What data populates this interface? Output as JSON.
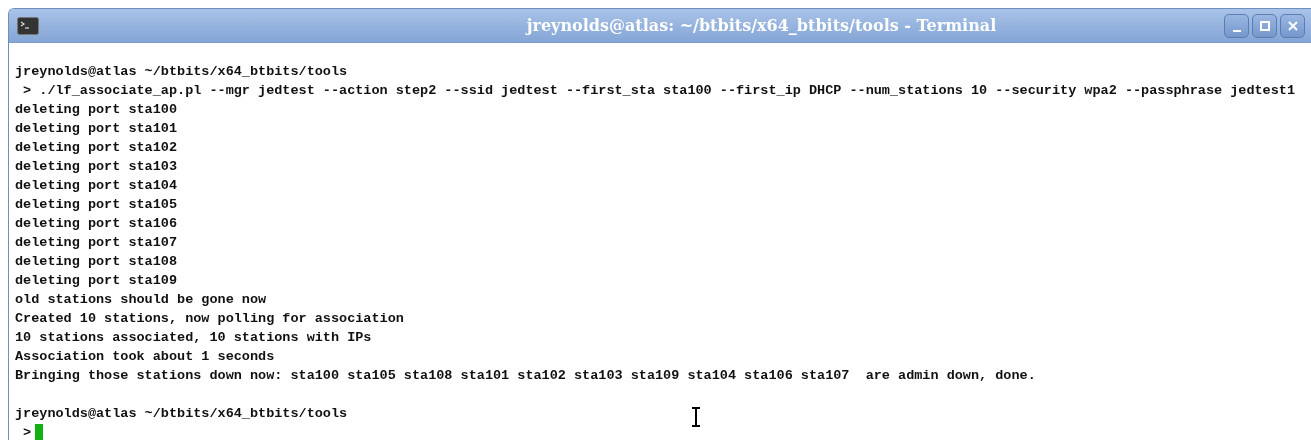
{
  "window": {
    "title": "jreynolds@atlas: ~/btbits/x64_btbits/tools - Terminal"
  },
  "terminal": {
    "lines": [
      {
        "kind": "blank"
      },
      {
        "kind": "text",
        "text": "jreynolds@atlas ~/btbits/x64_btbits/tools"
      },
      {
        "kind": "text",
        "text": " > ./lf_associate_ap.pl --mgr jedtest --action step2 --ssid jedtest --first_sta sta100 --first_ip DHCP --num_stations 10 --security wpa2 --passphrase jedtest1"
      },
      {
        "kind": "text",
        "text": "deleting port sta100"
      },
      {
        "kind": "text",
        "text": "deleting port sta101"
      },
      {
        "kind": "text",
        "text": "deleting port sta102"
      },
      {
        "kind": "text",
        "text": "deleting port sta103"
      },
      {
        "kind": "text",
        "text": "deleting port sta104"
      },
      {
        "kind": "text",
        "text": "deleting port sta105"
      },
      {
        "kind": "text",
        "text": "deleting port sta106"
      },
      {
        "kind": "text",
        "text": "deleting port sta107"
      },
      {
        "kind": "text",
        "text": "deleting port sta108"
      },
      {
        "kind": "text",
        "text": "deleting port sta109"
      },
      {
        "kind": "text",
        "text": "old stations should be gone now"
      },
      {
        "kind": "text",
        "text": "Created 10 stations, now polling for association"
      },
      {
        "kind": "text",
        "text": "10 stations associated, 10 stations with IPs"
      },
      {
        "kind": "text",
        "text": "Association took about 1 seconds"
      },
      {
        "kind": "text",
        "text": "Bringing those stations down now: sta100 sta105 sta108 sta101 sta102 sta103 sta109 sta104 sta106 sta107  are admin down, done."
      },
      {
        "kind": "blank"
      },
      {
        "kind": "text",
        "text": "jreynolds@atlas ~/btbits/x64_btbits/tools"
      },
      {
        "kind": "cursor",
        "text": " >"
      }
    ]
  }
}
